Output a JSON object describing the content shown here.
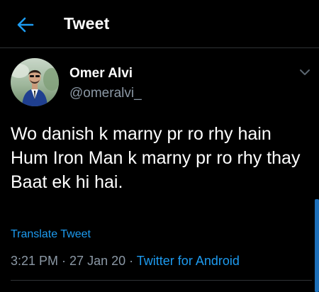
{
  "header": {
    "title": "Tweet",
    "back_icon": "arrow-left-icon"
  },
  "author": {
    "name": "Omer Alvi",
    "handle": "@omeralvi_",
    "more_icon": "chevron-down-icon"
  },
  "tweet": {
    "text": "Wo danish k marny pr ro rhy hain\nHum Iron Man k marny pr ro rhy thay\nBaat ek hi hai.",
    "translate_label": "Translate Tweet",
    "time": "3:21 PM",
    "separator1": " · ",
    "date": "27 Jan 20",
    "separator2": " · ",
    "source": "Twitter for Android"
  },
  "colors": {
    "background": "#000000",
    "accent": "#1d9bf0",
    "secondary_text": "#8b98a5",
    "divider": "#2f3336"
  }
}
